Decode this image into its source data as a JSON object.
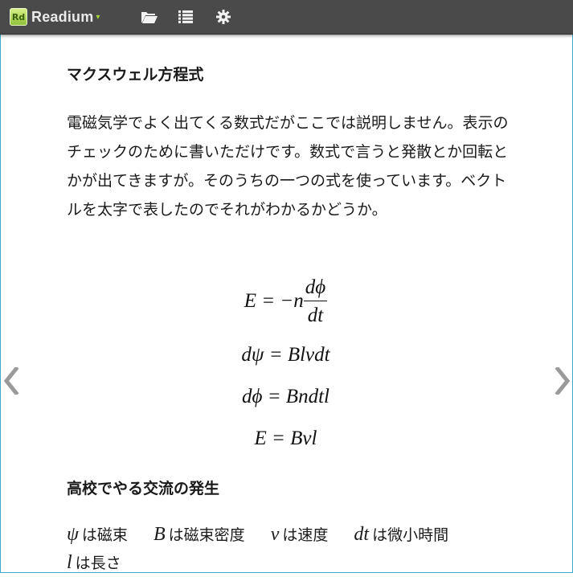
{
  "app": {
    "name": "Readium"
  },
  "toolbar": {
    "icons": [
      "folder-open-icon",
      "list-icon",
      "gear-icon"
    ]
  },
  "content": {
    "heading1": "マクスウェル方程式",
    "paragraph": "電磁気学でよく出てくる数式だがここでは説明しません。表示のチェックのために書いただけです。数式で言うと発散とか回転とかが出てきますが。そのうちの一つの式を使っています。ベクトルを太字で表したのでそれがわかるかどうか。",
    "equations": {
      "eq1_lhs": "E = −n",
      "eq1_num": "dϕ",
      "eq1_den": "dt",
      "eq2": "dψ = Blvdt",
      "eq3": "dϕ = Bndtl",
      "eq4": "E = Bvl"
    },
    "heading2": "高校でやる交流の発生",
    "variables": [
      {
        "symbol": "ψ",
        "text": "は磁束"
      },
      {
        "symbol": "B",
        "text": "は磁束密度"
      },
      {
        "symbol": "v",
        "text": "は速度"
      },
      {
        "symbol": "dt",
        "text": "は微小時間"
      },
      {
        "symbol": "l",
        "text": "は長さ"
      }
    ]
  },
  "colors": {
    "toolbar": "#4a4a4a",
    "accent": "#8fc23a",
    "border": "#3fa9c9",
    "arrow": "#9a9a9a"
  }
}
